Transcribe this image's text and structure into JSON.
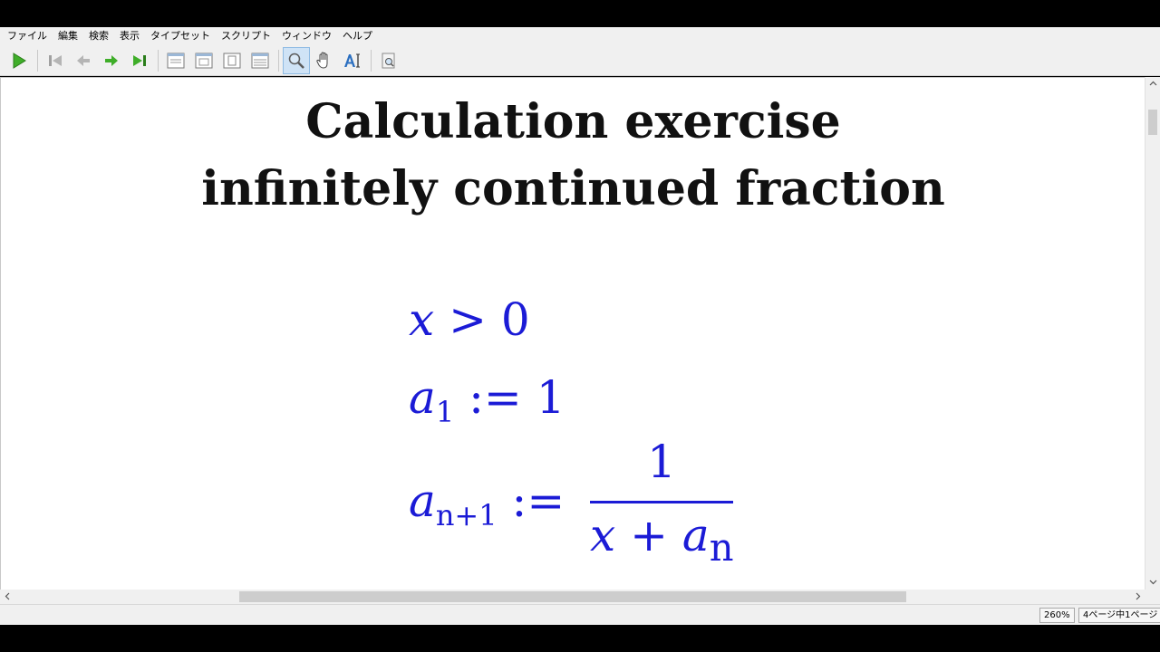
{
  "menu": [
    "ファイル",
    "編集",
    "検索",
    "表示",
    "タイプセット",
    "スクリプト",
    "ウィンドウ",
    "ヘルプ"
  ],
  "toolbar": {
    "buttons": [
      "typeset-icon",
      "first-page-icon",
      "previous-page-icon",
      "next-page-icon",
      "last-page-icon",
      "single-page-icon",
      "continuous-page-icon",
      "fit-page-icon",
      "fit-width-icon",
      "magnifier-icon",
      "hand-tool-icon",
      "select-text-icon",
      "goto-source-icon"
    ],
    "active": "magnifier-icon"
  },
  "document": {
    "title_line1": "Calculation exercise",
    "title_line2": "infinitely continued fraction",
    "math": {
      "line1": {
        "var": "x",
        "rest": " > 0"
      },
      "line2": {
        "var": "a",
        "sub": "1",
        "rest": " := 1"
      },
      "line3": {
        "var": "a",
        "sub": "n+1",
        "rest": " :=",
        "numerator": "1",
        "denominator_var1": "x",
        "denominator_op": " + ",
        "denominator_var2": "a",
        "denominator_sub": "n"
      }
    },
    "text_color": "#1b1bd6"
  },
  "status": {
    "zoom": "260%",
    "page": "4ページ中1ページ"
  }
}
